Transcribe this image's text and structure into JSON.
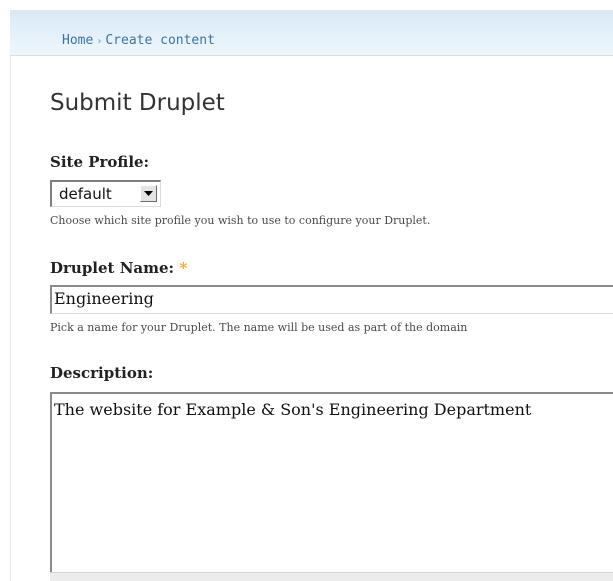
{
  "breadcrumb": {
    "home": "Home",
    "separator": "›",
    "current": "Create content"
  },
  "page": {
    "title": "Submit Druplet"
  },
  "form": {
    "site_profile": {
      "label": "Site Profile:",
      "selected": "default",
      "help": "Choose which site profile you wish to use to configure your Druplet."
    },
    "druplet_name": {
      "label": "Druplet Name:",
      "required_marker": "*",
      "value": "Engineering",
      "help": "Pick a name for your Druplet. The name will be used as part of the domain"
    },
    "description": {
      "label": "Description:",
      "value": "The website for Example & Son's Engineering Department"
    }
  },
  "colors": {
    "link": "#3a74a8",
    "required": "#f5a623",
    "breadcrumb_bg": "#e6f1f9"
  }
}
